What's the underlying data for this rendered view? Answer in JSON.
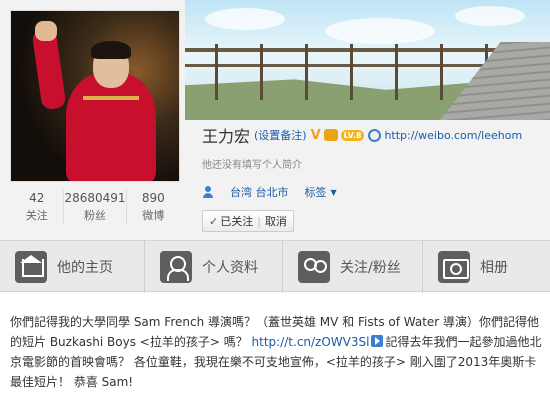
{
  "profile": {
    "name": "王力宏",
    "remark_label": "(设置备注)",
    "verified_badge": "V",
    "level_badge": "LV.8",
    "url": "http://weibo.com/leehom",
    "bio": "他还没有填写个人简介",
    "location": "台湾 台北市",
    "tags_label": "标签",
    "stats": [
      {
        "value": "42",
        "label": "关注"
      },
      {
        "value": "28680491",
        "label": "粉丝"
      },
      {
        "value": "890",
        "label": "微博"
      }
    ],
    "follow": {
      "status": "已关注",
      "cancel": "取消"
    }
  },
  "nav": [
    {
      "label": "他的主页",
      "icon": "home-icon"
    },
    {
      "label": "个人资料",
      "icon": "user-icon"
    },
    {
      "label": "关注/粉丝",
      "icon": "fans-icon"
    },
    {
      "label": "相册",
      "icon": "camera-icon"
    }
  ],
  "post": {
    "text_before": "你們記得我的大學同學 Sam French 導演嗎？（蓋世英雄 MV 和 Fists of Water 導演）你們記得他的短片 Buzkashi Boys <拉羊的孩子> 嗎？ ",
    "link": "http://t.cn/zOWV3Sl",
    "text_after": "記得去年我們一起參加過他北京電影節的首映會嗎？ 各位童鞋，我現在樂不可支地宣佈，<拉羊的孩子> 剛入圍了2013年奧斯卡最佳短片！ 恭喜 Sam!"
  },
  "colors": {
    "link": "#1a5ba8",
    "nav_bg": "#e9e9e9",
    "icon_bg": "#5e5e5e",
    "shirt": "#c8102e"
  }
}
